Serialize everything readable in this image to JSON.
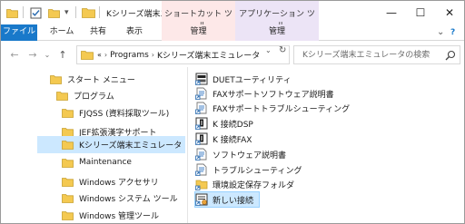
{
  "window": {
    "title": "Kシリーズ端末エミュレ...",
    "minimize_glyph": "—",
    "maximize_glyph": "☐",
    "close_glyph": "✕"
  },
  "context_tabs": {
    "shortcut_tools": "ショートカット ツール",
    "application_tools": "アプリケーション ツール"
  },
  "ribbon": {
    "tabs": [
      "ファイル",
      "ホーム",
      "共有",
      "表示",
      "管理",
      "管理"
    ],
    "collapse_glyph": "⌄",
    "help_glyph": "?"
  },
  "nav": {
    "back_glyph": "←",
    "forward_glyph": "→",
    "recent_glyph": "⌄",
    "up_glyph": "↑"
  },
  "address": {
    "overflow": "«",
    "crumbs": [
      "Programs",
      "Kシリーズ端末エミュレータ"
    ],
    "separator": "›",
    "dropdown_glyph": "⌄",
    "refresh_glyph": "↻"
  },
  "search": {
    "placeholder": "Kシリーズ端末エミュレータの検索"
  },
  "nav_pane": {
    "items": [
      {
        "label": "スタート メニュー"
      },
      {
        "label": "プログラム"
      },
      {
        "label": "FJQSS (資料採取ツール)"
      },
      {
        "label": "JEF拡張漢字サポート"
      },
      {
        "label": "Kシリーズ端末エミュレータ"
      },
      {
        "label": "Maintenance"
      },
      {
        "label": "Windows アクセサリ"
      },
      {
        "label": "Windows システム ツール"
      },
      {
        "label": "Windows 管理ツール"
      }
    ]
  },
  "files": [
    {
      "label": "DUETユーティリティ",
      "icon": "app-shortcut-icon"
    },
    {
      "label": "FAXサポートソフトウェア説明書",
      "icon": "document-shortcut-icon"
    },
    {
      "label": "FAXサポートトラブルシューティング",
      "icon": "document-shortcut-icon"
    },
    {
      "label": "K 接続DSP",
      "icon": "terminal-shortcut-icon"
    },
    {
      "label": "K 接続FAX",
      "icon": "terminal-shortcut-icon"
    },
    {
      "label": "ソフトウェア説明書",
      "icon": "document-shortcut-icon"
    },
    {
      "label": "トラブルシューティング",
      "icon": "document-shortcut-icon"
    },
    {
      "label": "環境設定保存フォルダ",
      "icon": "folder-shortcut-icon"
    },
    {
      "label": "新しい接続",
      "icon": "new-connection-icon"
    }
  ],
  "colors": {
    "file_tab": "#1979ca",
    "shortcut_context": "#fde8e8",
    "application_context": "#ece4f6",
    "selection": "#cce8ff",
    "folder": "#f4c951"
  }
}
